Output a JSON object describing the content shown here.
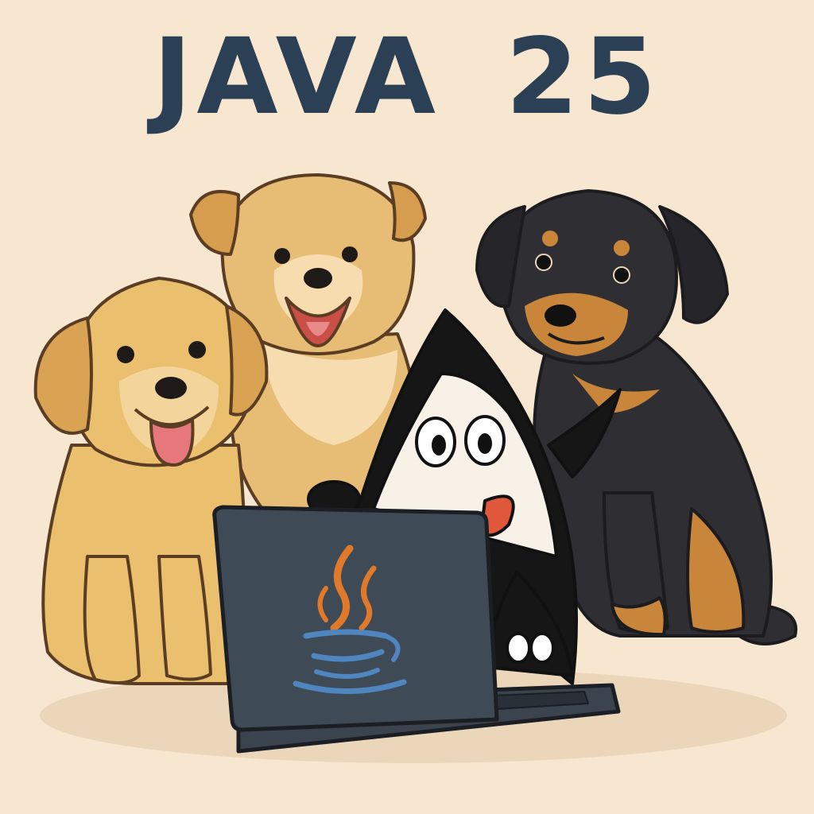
{
  "title": "JAVA 25",
  "colors": {
    "background": "#f7e6d0",
    "title": "#2b3f55",
    "golden_fur": "#eabf6e",
    "fluffy_fur": "#e3b368",
    "black_fur": "#2f2f33",
    "tan_fur": "#c9863a",
    "laptop": "#3f4a57",
    "java_steam": "#e07a2a",
    "java_cup": "#4f86bf"
  },
  "characters": [
    {
      "kind": "golden-retriever-puppy",
      "position_word": "left"
    },
    {
      "kind": "fluffy-puppy",
      "position_word": "back-center"
    },
    {
      "kind": "black-and-tan-puppy",
      "position_word": "right"
    },
    {
      "kind": "duke-mascot",
      "position_word": "center"
    }
  ],
  "laptop_logo": "java-cup-icon"
}
